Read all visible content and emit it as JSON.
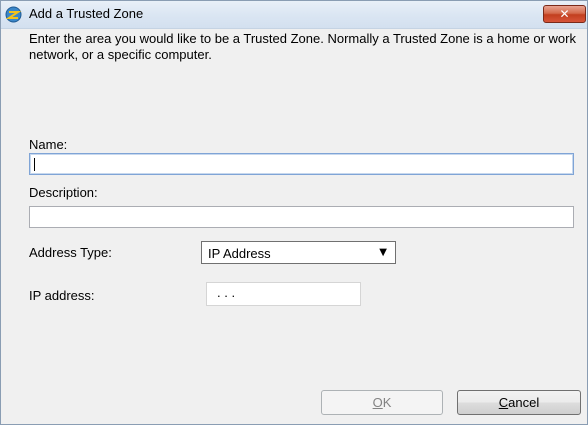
{
  "window": {
    "title": "Add a Trusted Zone",
    "close_symbol": "✕",
    "title_icon": "zonealarm-icon"
  },
  "instructions": "Enter the area you would like to be a Trusted Zone. Normally a Trusted Zone is a home or work network, or a specific computer.",
  "form": {
    "name_label": "Name:",
    "name_value": "",
    "description_label": "Description:",
    "description_value": "",
    "address_type_label": "Address Type:",
    "address_type_value": "IP Address",
    "ip_address_label": "IP address:",
    "ip_address_value": ". . ."
  },
  "buttons": {
    "ok": {
      "mnemonic": "O",
      "rest": "K"
    },
    "cancel": {
      "mnemonic": "C",
      "rest": "ancel"
    }
  },
  "colors": {
    "close_button": "#c94a2c",
    "focus_border": "#7fa4d6"
  }
}
